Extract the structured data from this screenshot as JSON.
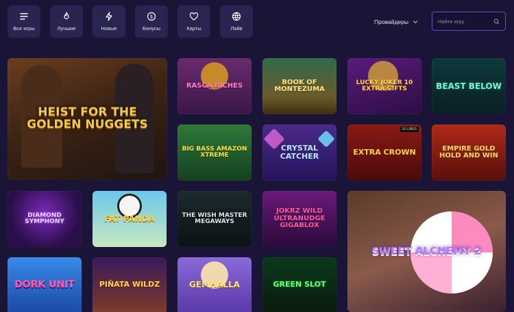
{
  "categories": [
    {
      "label": "Все игры",
      "icon": "menu-lines-icon"
    },
    {
      "label": "Лучшие",
      "icon": "flame-icon"
    },
    {
      "label": "Новые",
      "icon": "lightning-icon"
    },
    {
      "label": "Бонусы",
      "icon": "dollar-coin-icon"
    },
    {
      "label": "Карты",
      "icon": "heart-icon"
    },
    {
      "label": "Лайв",
      "icon": "globe-icon"
    }
  ],
  "providers": {
    "label": "Провайдеры"
  },
  "search": {
    "placeholder": "Найти игру"
  },
  "games": [
    {
      "title": "Heist for the Golden Nuggets"
    },
    {
      "title": "Rasca Riches"
    },
    {
      "title": "Book of Montezuma"
    },
    {
      "title": "Lucky Joker 10 Extra Gifts"
    },
    {
      "title": "Beast Below"
    },
    {
      "title": "Big Bass Amazon Xtreme"
    },
    {
      "title": "Crystal Catcher"
    },
    {
      "title": "Extra Crown"
    },
    {
      "title": "Empire Gold Hold and Win"
    },
    {
      "title": "Diamond Symphony"
    },
    {
      "title": "Fat Panda"
    },
    {
      "title": "The Wish Master Megaways"
    },
    {
      "title": "Jokrz Wild Ultranudge Gigablox"
    },
    {
      "title": "Sweet Alchemy 2"
    },
    {
      "title": "Dork Unit"
    },
    {
      "title": "Piñata Wildz"
    },
    {
      "title": "Gemhalla"
    },
    {
      "title": "Green Slot"
    }
  ],
  "badges": {
    "extra_crown": "10 LINES"
  },
  "colors": {
    "background": "#1a1436",
    "card": "#2a2450",
    "accent": "#5a4fc4"
  }
}
